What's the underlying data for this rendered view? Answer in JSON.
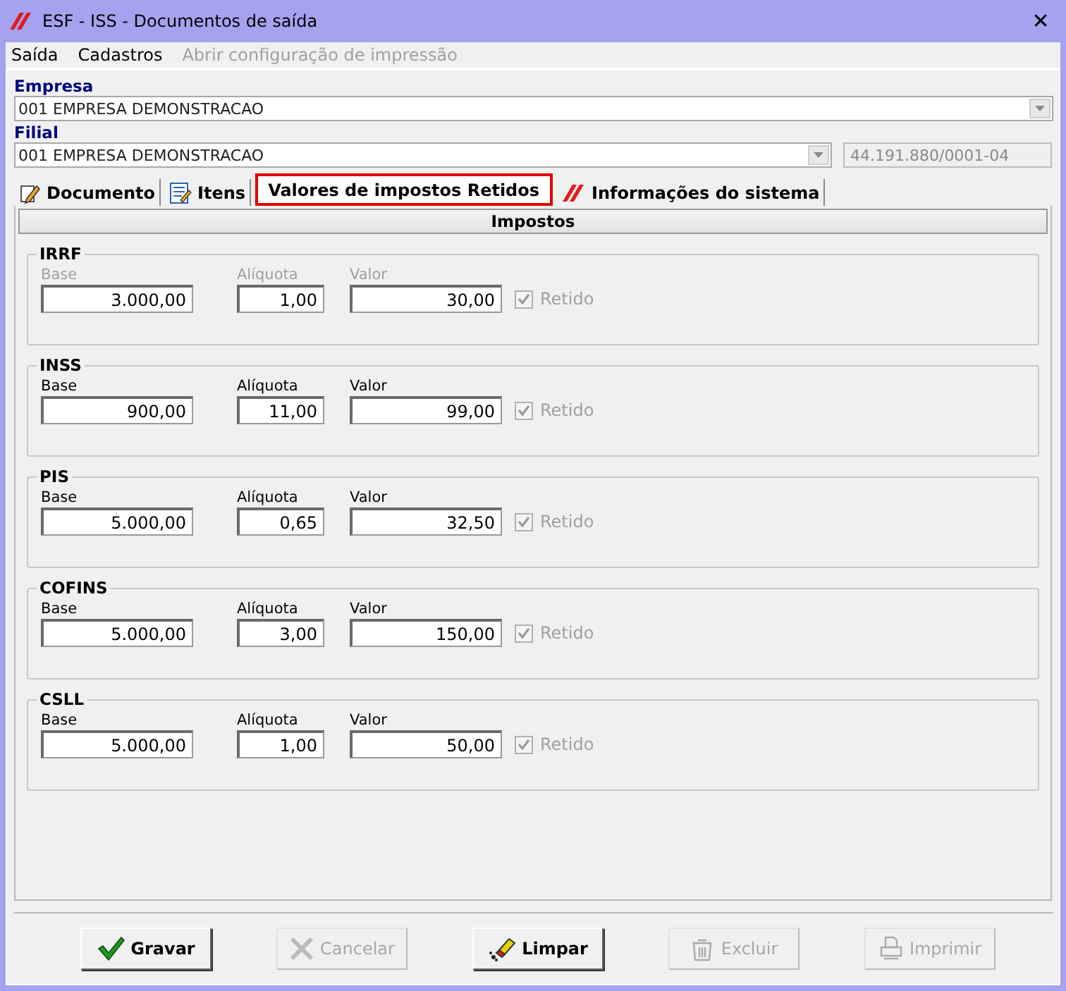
{
  "window": {
    "title": "ESF - ISS - Documentos de saída",
    "close": "✕"
  },
  "menu": [
    {
      "label": "Saída",
      "disabled": false
    },
    {
      "label": "Cadastros",
      "disabled": false
    },
    {
      "label": "Abrir configuração de impressão",
      "disabled": true
    }
  ],
  "empresa": {
    "label": "Empresa",
    "value": "001 EMPRESA DEMONSTRACAO"
  },
  "filial": {
    "label": "Filial",
    "value": "001 EMPRESA DEMONSTRACAO",
    "cnpj": "44.191.880/0001-04"
  },
  "tabs": [
    {
      "label": "Documento",
      "selected": false
    },
    {
      "label": "Itens",
      "selected": false
    },
    {
      "label": "Valores de impostos Retidos",
      "selected": true
    },
    {
      "label": "Informações do sistema",
      "selected": false
    }
  ],
  "section_title": "Impostos",
  "taxes": [
    {
      "name": "IRRF",
      "disabled": true,
      "base_label": "Base",
      "base": "3.000,00",
      "rate_label": "Alíquota",
      "rate": "1,00",
      "value_label": "Valor",
      "value": "30,00",
      "retido_label": "Retido",
      "retido": true
    },
    {
      "name": "INSS",
      "disabled": false,
      "base_label": "Base",
      "base": "900,00",
      "rate_label": "Alíquota",
      "rate": "11,00",
      "value_label": "Valor",
      "value": "99,00",
      "retido_label": "Retido",
      "retido": true
    },
    {
      "name": "PIS",
      "disabled": false,
      "base_label": "Base",
      "base": "5.000,00",
      "rate_label": "Alíquota",
      "rate": "0,65",
      "value_label": "Valor",
      "value": "32,50",
      "retido_label": "Retido",
      "retido": true
    },
    {
      "name": "COFINS",
      "disabled": false,
      "base_label": "Base",
      "base": "5.000,00",
      "rate_label": "Alíquota",
      "rate": "3,00",
      "value_label": "Valor",
      "value": "150,00",
      "retido_label": "Retido",
      "retido": true
    },
    {
      "name": "CSLL",
      "disabled": false,
      "base_label": "Base",
      "base": "5.000,00",
      "rate_label": "Alíquota",
      "rate": "1,00",
      "value_label": "Valor",
      "value": "50,00",
      "retido_label": "Retido",
      "retido": true
    }
  ],
  "buttons": [
    {
      "label": "Gravar",
      "disabled": false
    },
    {
      "label": "Cancelar",
      "disabled": true
    },
    {
      "label": "Limpar",
      "disabled": false
    },
    {
      "label": "Excluir",
      "disabled": true
    },
    {
      "label": "Imprimir",
      "disabled": true
    }
  ]
}
